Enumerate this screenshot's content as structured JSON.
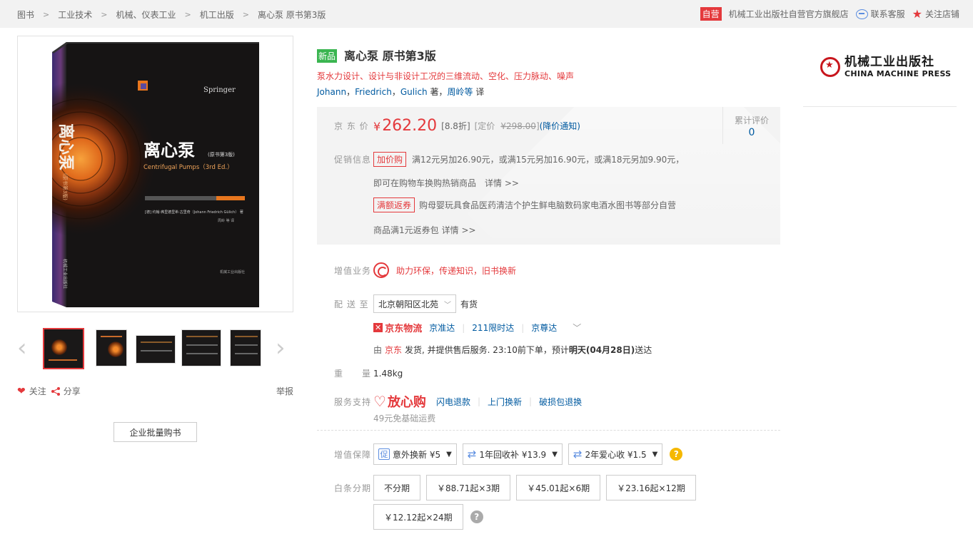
{
  "breadcrumb": [
    "图书",
    "工业技术",
    "机械、仪表工业",
    "机工出版",
    "离心泵 原书第3版"
  ],
  "shop": {
    "badge": "自营",
    "name": "机械工业出版社自营官方旗舰店",
    "contact": "联系客服",
    "follow_shop": "关注店铺"
  },
  "cover": {
    "title": "离心泵",
    "edition_tag": "(原书第3版)",
    "en_title": "Centrifugal Pumps（3rd Ed.）",
    "spine_title": "离心泵",
    "publisher_mark": "Springer",
    "authors_line": "[德] 约翰·弗里德里希·古里奇（Johann Friedrich Gülich） 著",
    "translators_line": "周岭 等 译",
    "bottom_publisher": "机械工业出版社",
    "spine_sub": "(原书第3版)",
    "spine_press": "机械工业出版社"
  },
  "actions": {
    "follow": "关注",
    "share": "分享",
    "report": "举报"
  },
  "bulk_buy": "企业批量购书",
  "product": {
    "new_tag": "新品",
    "title": "离心泵 原书第3版",
    "subtitle": "泵水力设计、设计与非设计工况的三维流动、空化、压力脉动、噪声",
    "authors": [
      "Johann",
      "Friedrich",
      "Gulich"
    ],
    "author_role": "著",
    "translator": "周岭等",
    "translator_role": "译",
    "sep": "，"
  },
  "price": {
    "label": "京 东 价",
    "currency": "¥",
    "value": "262.20",
    "discount": "[8.8折]",
    "list_label": "[定价",
    "list_price": "¥298.00",
    "list_close": "]",
    "notify": "(降价通知)"
  },
  "rating": {
    "label": "累计评价",
    "count": "0"
  },
  "promo": {
    "label": "促销信息",
    "items": [
      {
        "tag": "加价购",
        "line1": "满12元另加26.90元，或满15元另加16.90元，或满18元另加9.90元，",
        "line2": "即可在购物车换购热销商品",
        "more": "详情 >>"
      },
      {
        "tag": "满额返券",
        "line1": "购母婴玩具食品医药清洁个护生鲜电脑数码家电酒水图书等部分自营",
        "line2": "商品满1元返券包",
        "more": "详情 >>"
      }
    ]
  },
  "value_added": {
    "label": "增值业务",
    "text": "助力环保，传递知识，旧书换新"
  },
  "delivery": {
    "label": "配 送 至",
    "address": "北京朝阳区北苑",
    "stock": "有货",
    "logistics_logo": "京东物流",
    "services": [
      "京准达",
      "211限时达",
      "京尊达"
    ],
    "ship_prefix": "由",
    "ship_by": "京东",
    "ship_text": "发货, 并提供售后服务. 23:10前下单，预计",
    "eta": "明天(04月28日)",
    "ship_suffix": "送达"
  },
  "weight": {
    "label": "重　　量",
    "value": "1.48kg"
  },
  "service": {
    "label": "服务支持",
    "brand": "放心购",
    "items": [
      "闪电退款",
      "上门换新",
      "破损包退换"
    ],
    "note": "49元免基础运费"
  },
  "protection": {
    "label": "增值保障",
    "options": [
      {
        "icon": "促",
        "text": "意外换新 ¥5"
      },
      {
        "icon": "⇄",
        "text": "1年回收补  ¥13.9"
      },
      {
        "icon": "⇄",
        "text": "2年爱心收 ¥1.5"
      }
    ]
  },
  "installment": {
    "label": "白条分期",
    "options": [
      "不分期",
      "￥88.71起×3期",
      "￥45.01起×6期",
      "￥23.16起×12期",
      "￥12.12起×24期"
    ]
  },
  "publisher": {
    "cn": "机械工业出版社",
    "en": "CHINA MACHINE PRESS"
  },
  "colors": {
    "accent": "#e4393c",
    "link": "#005aa0",
    "new": "#3ab550"
  }
}
